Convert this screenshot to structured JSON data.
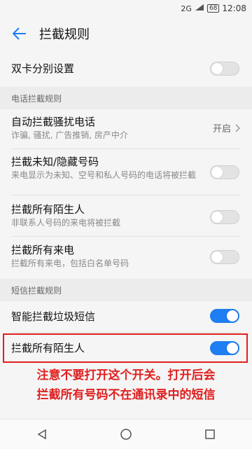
{
  "status_bar": {
    "time": "12:08",
    "battery": "68",
    "network": "2G"
  },
  "header": {
    "title": "拦截规则"
  },
  "dual_sim": {
    "label": "双卡分别设置",
    "enabled": false
  },
  "call_section": {
    "header": "电话拦截规则",
    "items": [
      {
        "title": "自动拦截骚扰电话",
        "subtitle": "诈骗, 骚扰, 广告推销, 房产中介",
        "value": "开启"
      },
      {
        "title": "拦截未知/隐藏号码",
        "subtitle": "来电显示为未知、空号和私人号码的电话将被拦截",
        "enabled": false
      },
      {
        "title": "拦截所有陌生人",
        "subtitle": "非联系人号码的来电将被拦截",
        "enabled": false
      },
      {
        "title": "拦截所有来电",
        "subtitle": "拦截所有来电，包括白名单号码",
        "enabled": false
      }
    ]
  },
  "sms_section": {
    "header": "短信拦截规则",
    "items": [
      {
        "title": "智能拦截垃圾短信",
        "enabled": true
      },
      {
        "title": "拦截所有陌生人",
        "enabled": true
      }
    ]
  },
  "annotation": {
    "line1": "注意不要打开这个开关。打开后会",
    "line2": "拦截所有号码不在通讯录中的短信",
    "color": "#e02020"
  },
  "colors": {
    "accent": "#1e7ef2",
    "toggle_off": "#e3e3e3"
  }
}
